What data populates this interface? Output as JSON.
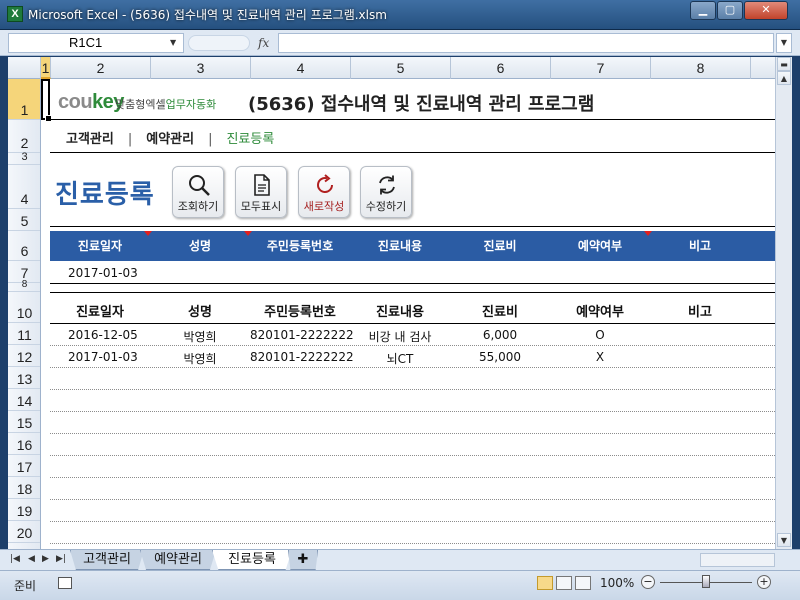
{
  "window": {
    "title": "Microsoft Excel - (5636) 접수내역 및 진료내역 관리 프로그램.xlsm",
    "app_icon": "X",
    "minimize": "▁",
    "maximize": "▢",
    "close": "✕"
  },
  "formula_bar": {
    "name_box": "R1C1",
    "fx": "fx",
    "formula": ""
  },
  "column_headers": [
    "1",
    "2",
    "3",
    "4",
    "5",
    "6",
    "7",
    "8"
  ],
  "row_headers": [
    "1",
    "2",
    "3",
    "4",
    "5",
    "6",
    "7",
    "8",
    "10",
    "11",
    "12",
    "13",
    "14",
    "15",
    "16",
    "17",
    "18",
    "19",
    "20",
    "21"
  ],
  "brand": {
    "logo_cou": "cou",
    "logo_key": "key",
    "sub_a": "맞춤형엑셀",
    "sub_b": "업무자동화"
  },
  "page_title": "(5636) 접수내역 및 진료내역 관리 프로그램",
  "nav": {
    "items": [
      "고객관리",
      "예약관리",
      "진료등록"
    ],
    "separator": "|",
    "active": "진료등록"
  },
  "section_title": "진료등록",
  "toolbar": {
    "search": "조회하기",
    "show_all": "모두표시",
    "new": "새로작성",
    "edit": "수정하기"
  },
  "input_table": {
    "headers": [
      "진료일자",
      "성명",
      "주민등록번호",
      "진료내용",
      "진료비",
      "예약여부",
      "비고"
    ],
    "row": [
      "2017-01-03",
      "",
      "",
      "",
      "",
      "",
      ""
    ]
  },
  "records_table": {
    "headers": [
      "진료일자",
      "성명",
      "주민등록번호",
      "진료내용",
      "진료비",
      "예약여부",
      "비고"
    ],
    "rows": [
      [
        "2016-12-05",
        "박영희",
        "820101-2222222",
        "비강 내 검사",
        "6,000",
        "O",
        ""
      ],
      [
        "2017-01-03",
        "박영희",
        "820101-2222222",
        "뇌CT",
        "55,000",
        "X",
        ""
      ]
    ]
  },
  "sheet_tabs": [
    "고객관리",
    "예약관리",
    "진료등록"
  ],
  "active_sheet": "진료등록",
  "status": {
    "ready": "준비",
    "zoom": "100%"
  },
  "colors": {
    "accent_blue": "#2b5ca4",
    "brand_green": "#2e8b3a",
    "marker_red": "#e02020"
  }
}
